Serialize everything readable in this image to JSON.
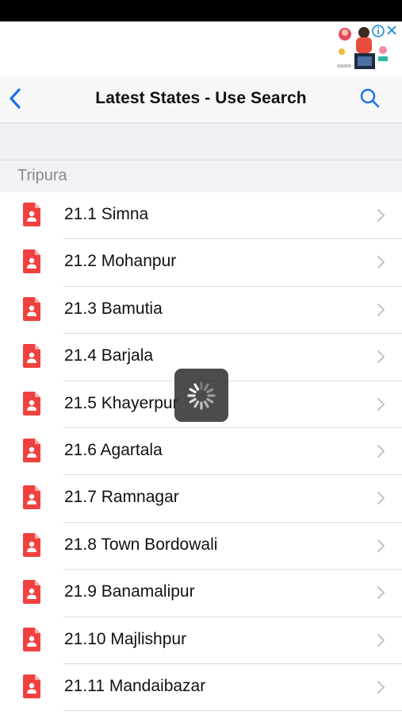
{
  "nav": {
    "title": "Latest States - Use Search"
  },
  "section": {
    "header": "Tripura"
  },
  "items": [
    {
      "label": "21.1 Simna"
    },
    {
      "label": "21.2 Mohanpur"
    },
    {
      "label": "21.3 Bamutia"
    },
    {
      "label": "21.4 Barjala"
    },
    {
      "label": "21.5 Khayerpur"
    },
    {
      "label": "21.6 Agartala"
    },
    {
      "label": "21.7 Ramnagar"
    },
    {
      "label": "21.8 Town Bordowali"
    },
    {
      "label": "21.9 Banamalipur"
    },
    {
      "label": "21.10 Majlishpur"
    },
    {
      "label": "21.11 Mandaibazar"
    }
  ],
  "icons": {
    "back": "chevron-left-icon",
    "search": "magnifier-icon",
    "item": "document-person-icon",
    "disclosure": "chevron-right-icon",
    "loading": "activity-spinner-icon",
    "ad_info": "info-icon",
    "ad_close": "close-icon"
  },
  "colors": {
    "accent": "#1a73e8",
    "doc_icon": "#f0413e",
    "status_bar": "#000000"
  }
}
